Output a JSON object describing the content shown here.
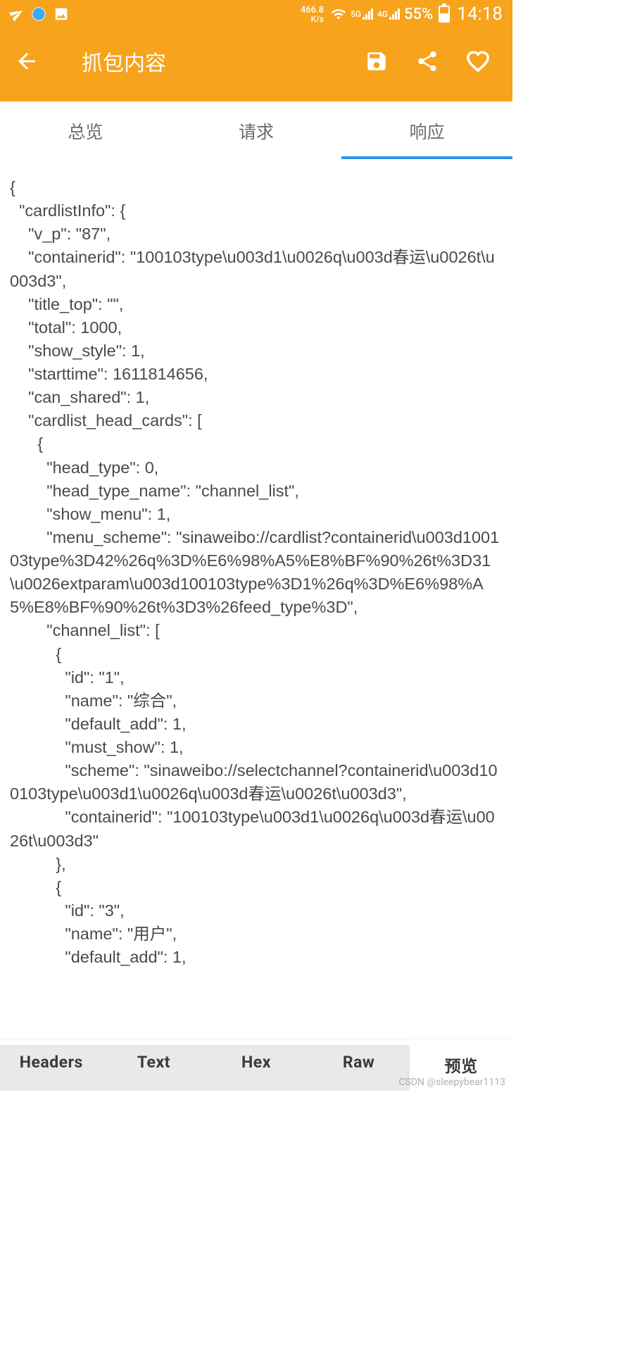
{
  "status": {
    "speed_value": "466.8",
    "speed_unit": "K/s",
    "sig1": "5G",
    "sig2": "4G",
    "battery_pct": "55%",
    "time": "14:18"
  },
  "header": {
    "title": "抓包内容"
  },
  "tabs": {
    "overview": "总览",
    "request": "请求",
    "response": "响应"
  },
  "bottom_tabs": {
    "headers": "Headers",
    "text": "Text",
    "hex": "Hex",
    "raw": "Raw",
    "preview": "预览"
  },
  "response_body": "{\n  \"cardlistInfo\": {\n    \"v_p\": \"87\",\n    \"containerid\": \"100103type\\u003d1\\u0026q\\u003d春运\\u0026t\\u003d3\",\n    \"title_top\": \"\",\n    \"total\": 1000,\n    \"show_style\": 1,\n    \"starttime\": 1611814656,\n    \"can_shared\": 1,\n    \"cardlist_head_cards\": [\n      {\n        \"head_type\": 0,\n        \"head_type_name\": \"channel_list\",\n        \"show_menu\": 1,\n        \"menu_scheme\": \"sinaweibo://cardlist?containerid\\u003d100103type%3D42%26q%3D%E6%98%A5%E8%BF%90%26t%3D31\\u0026extparam\\u003d100103type%3D1%26q%3D%E6%98%A5%E8%BF%90%26t%3D3%26feed_type%3D\",\n        \"channel_list\": [\n          {\n            \"id\": \"1\",\n            \"name\": \"综合\",\n            \"default_add\": 1,\n            \"must_show\": 1,\n            \"scheme\": \"sinaweibo://selectchannel?containerid\\u003d100103type\\u003d1\\u0026q\\u003d春运\\u0026t\\u003d3\",\n            \"containerid\": \"100103type\\u003d1\\u0026q\\u003d春运\\u0026t\\u003d3\"\n          },\n          {\n            \"id\": \"3\",\n            \"name\": \"用户\",\n            \"default_add\": 1,",
  "watermark": "CSDN @sleepybear1113"
}
